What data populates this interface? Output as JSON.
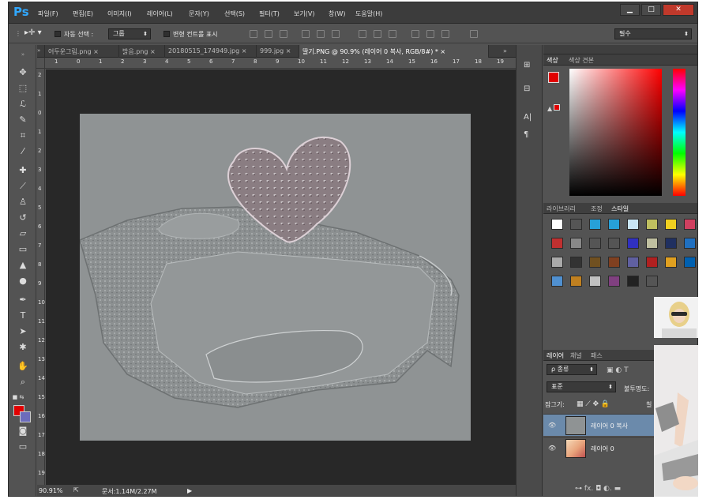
{
  "app": {
    "logo": "Ps",
    "menu": [
      "파일(F)",
      "편집(E)",
      "이미지(I)",
      "레이어(L)",
      "문자(Y)",
      "선택(S)",
      "필터(T)",
      "보기(V)",
      "창(W)",
      "도움말(H)"
    ],
    "window_buttons": [
      "▁",
      "□",
      "✕"
    ]
  },
  "options": {
    "auto_select_label": "자동 선택 :",
    "auto_select_value": "그룹",
    "transform_label": "변형 컨트롤 표시",
    "workspace_value": "필수"
  },
  "tabs": [
    {
      "label": "어두운그림.png ×"
    },
    {
      "label": "밝음.png ×"
    },
    {
      "label": "20180515_174949.jpg ×"
    },
    {
      "label": "999.jpg ×"
    },
    {
      "label": "딸기.PNG @ 90.9% (레이어 0 복사, RGB/8#) * ×"
    }
  ],
  "ruler_h": [
    "1",
    "0",
    "1",
    "2",
    "3",
    "4",
    "5",
    "6",
    "7",
    "8",
    "9",
    "10",
    "11",
    "12",
    "13",
    "14",
    "15",
    "16",
    "17",
    "18",
    "19"
  ],
  "ruler_v": [
    "2",
    "1",
    "0",
    "1",
    "2",
    "3",
    "4",
    "5",
    "6",
    "7",
    "8",
    "9",
    "10",
    "11",
    "12",
    "13",
    "14",
    "15",
    "16",
    "17",
    "18",
    "19"
  ],
  "status": {
    "zoom": "90.91%",
    "doc": "문서:1.14M/2.27M"
  },
  "color_panel": {
    "tabs": [
      "색상",
      "색상 견본"
    ]
  },
  "styles_panel": {
    "tabs": [
      "라이브러리",
      "조정",
      "스타일"
    ]
  },
  "layers_panel": {
    "tabs": [
      "레이어",
      "채널",
      "패스"
    ],
    "filter": "ρ 종류",
    "blend": "표준",
    "opacity_label": "불투명도:",
    "lock_label": "잠그기:",
    "fill_label": "칠",
    "layers": [
      {
        "name": "레이어 0 복사",
        "selected": true
      },
      {
        "name": "레이어 0",
        "selected": false
      }
    ],
    "footer_icons": [
      "link-icon",
      "fx-icon",
      "mask-icon",
      "adjustment-icon",
      "folder-icon"
    ]
  },
  "style_swatch_colors": [
    "#ffffff",
    "#555555",
    "#27a0d8",
    "#27a0d8",
    "#c9e6f5",
    "#c0c060",
    "#f0d020",
    "#d04060",
    "#c03030",
    "#888888",
    "#555555",
    "#555555",
    "#3030c0",
    "#c0c0a0",
    "#203060",
    "#2070c0",
    "#aaaaaa",
    "#333333",
    "#705020",
    "#804020",
    "#6060a0",
    "#b02020",
    "#e0a020",
    "#0060b0",
    "#5090d0",
    "#c08020",
    "#c0c0c0",
    "#804080",
    "#222222",
    "#555555"
  ]
}
